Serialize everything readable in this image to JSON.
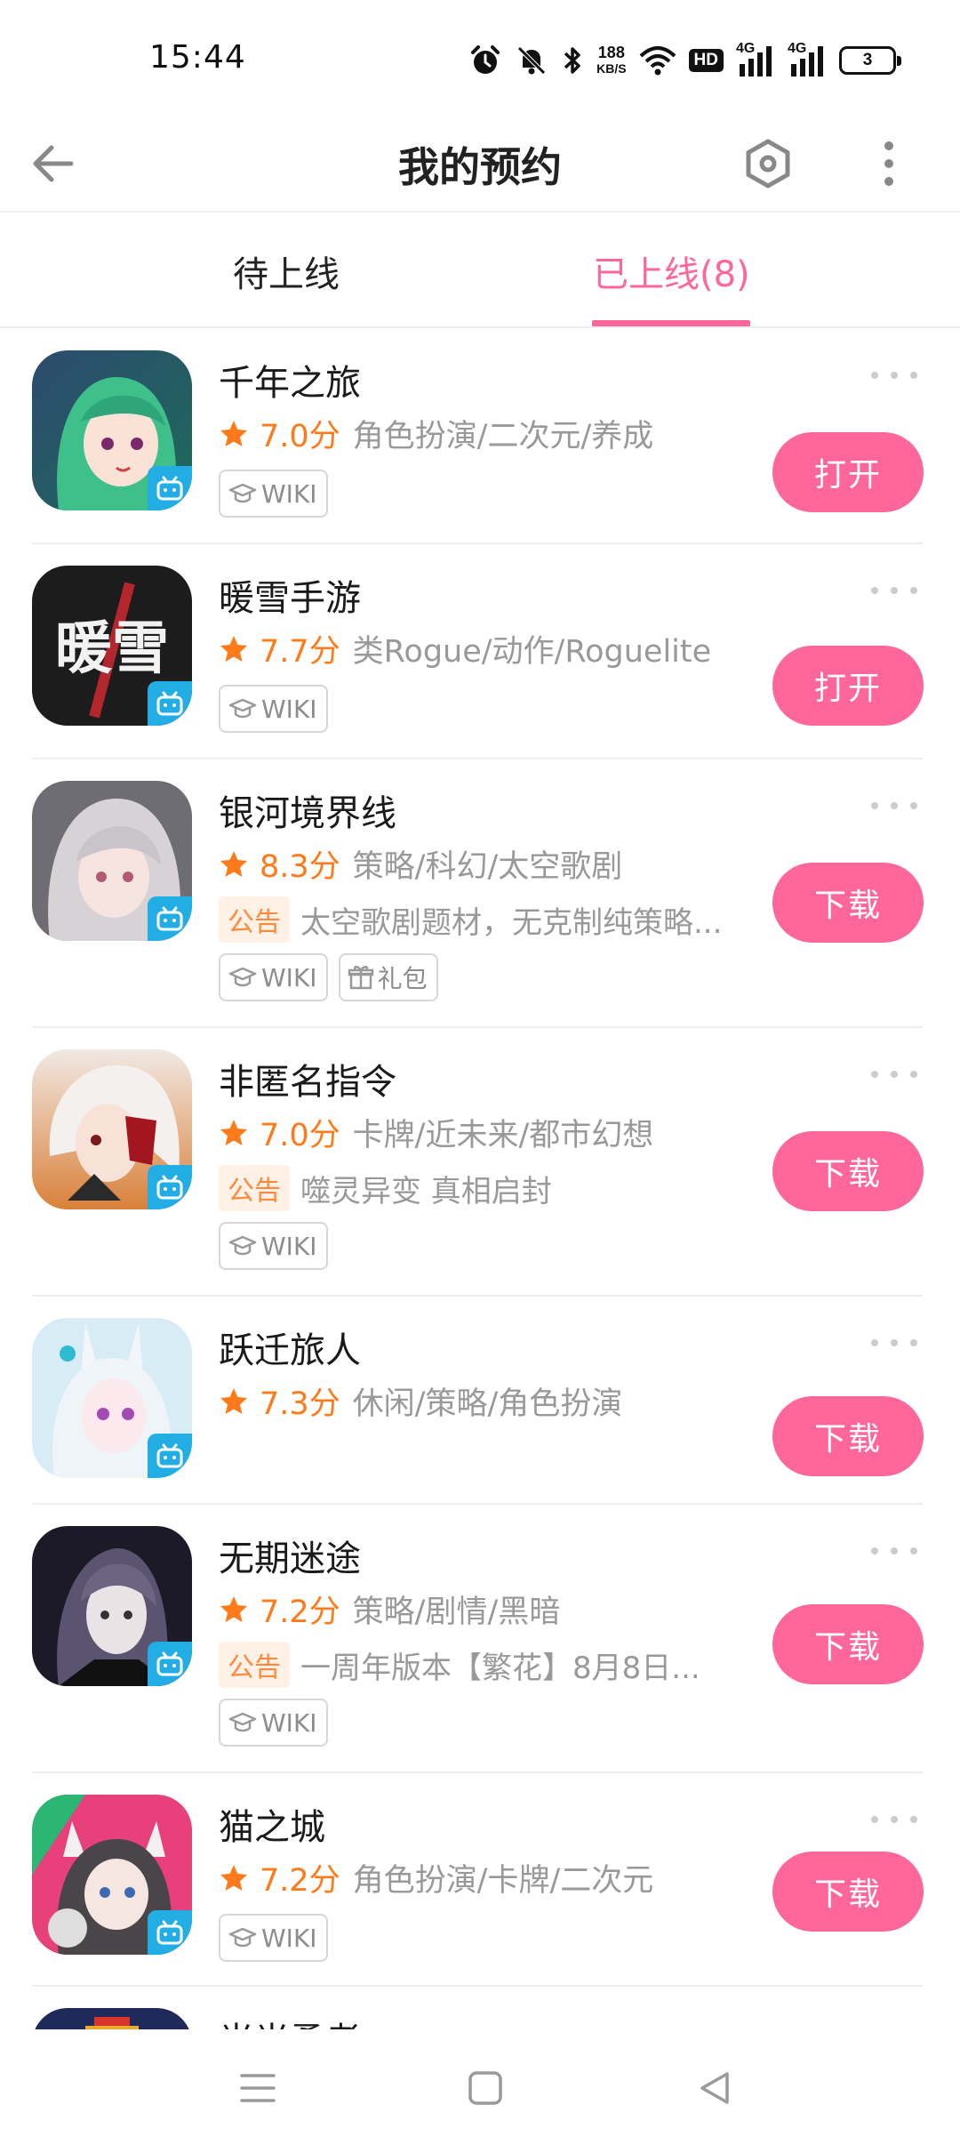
{
  "status_bar": {
    "time": "15:44",
    "net_speed_value": "188",
    "net_speed_unit": "KB/S",
    "hd_label": "HD",
    "signal_1": "4G",
    "signal_2": "4G",
    "battery": "3",
    "icons": [
      "alarm-icon",
      "mute-icon",
      "bluetooth-icon",
      "wifi-icon",
      "signal-icon",
      "battery-icon"
    ]
  },
  "header": {
    "title": "我的预约",
    "back_icon": "arrow-left-icon",
    "settings_icon": "hexagon-settings-icon",
    "more_icon": "vertical-dots-icon"
  },
  "tabs": [
    {
      "label": "待上线",
      "active": false
    },
    {
      "label": "已上线(8)",
      "active": true
    }
  ],
  "accent_color": "#ff6699",
  "score_color": "#ff7a1a",
  "games": [
    {
      "name": "千年之旅",
      "score": "7.0分",
      "tags": "角色扮演/二次元/养成",
      "notice_label": "",
      "notice": "",
      "chips": [
        "WIKI"
      ],
      "action": "打开"
    },
    {
      "name": "暖雪手游",
      "score": "7.7分",
      "tags": "类Rogue/动作/Roguelite",
      "notice_label": "",
      "notice": "",
      "chips": [
        "WIKI"
      ],
      "action": "打开",
      "icon_text": "暖雪"
    },
    {
      "name": "银河境界线",
      "score": "8.3分",
      "tags": "策略/科幻/太空歌剧",
      "notice_label": "公告",
      "notice": "太空歌剧题材，无克制纯策略...",
      "chips": [
        "WIKI",
        "礼包"
      ],
      "action": "下载"
    },
    {
      "name": "非匿名指令",
      "score": "7.0分",
      "tags": "卡牌/近未来/都市幻想",
      "notice_label": "公告",
      "notice": "噬灵异变 真相启封",
      "chips": [
        "WIKI"
      ],
      "action": "下载"
    },
    {
      "name": "跃迁旅人",
      "score": "7.3分",
      "tags": "休闲/策略/角色扮演",
      "notice_label": "",
      "notice": "",
      "chips": [],
      "action": "下载"
    },
    {
      "name": "无期迷途",
      "score": "7.2分",
      "tags": "策略/剧情/黑暗",
      "notice_label": "公告",
      "notice": "一周年版本【繁花】8月8日...",
      "chips": [
        "WIKI"
      ],
      "action": "下载"
    },
    {
      "name": "猫之城",
      "score": "7.2分",
      "tags": "角色扮演/卡牌/二次元",
      "notice_label": "",
      "notice": "",
      "chips": [
        "WIKI"
      ],
      "action": "下载"
    },
    {
      "name": "光光勇者",
      "score": "",
      "tags": "",
      "notice_label": "",
      "notice": "",
      "chips": [],
      "action": ""
    }
  ],
  "nav_bar": {
    "icons": [
      "menu-icon",
      "home-square-icon",
      "back-triangle-icon"
    ]
  }
}
